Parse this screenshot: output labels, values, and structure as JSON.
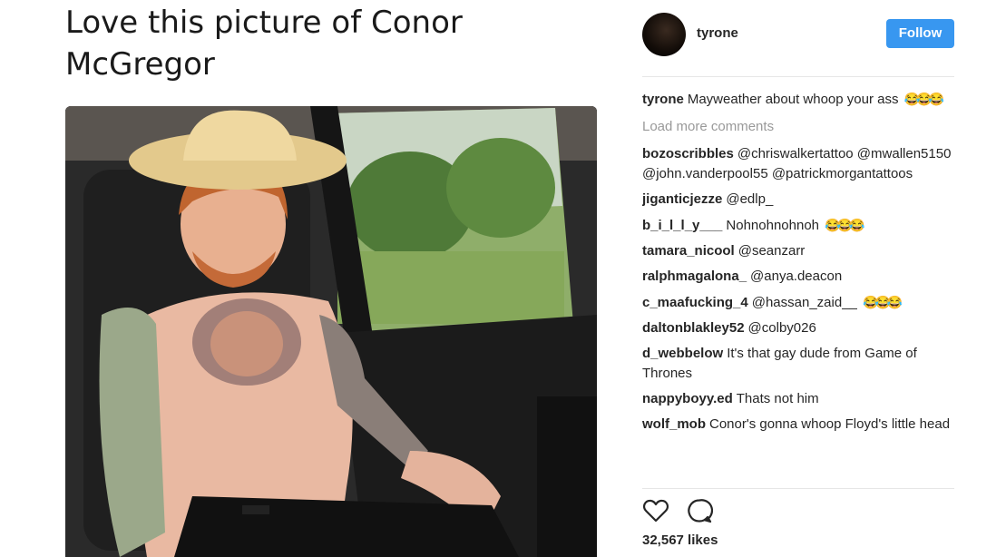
{
  "article": {
    "headline": "Love this picture of Conor McGregor"
  },
  "post": {
    "username": "tyrone",
    "follow_label": "Follow",
    "caption": {
      "user": "tyrone",
      "text": "Mayweather about whoop your ass",
      "emoji": "😂😂😂"
    },
    "load_more_label": "Load more comments",
    "comments": [
      {
        "user": "bozoscribbles",
        "text": "@chriswalkertattoo @mwallen5150 @john.vanderpool55 @patrickmorgantattoos",
        "emoji": ""
      },
      {
        "user": "jiganticjezze",
        "text": "@edlp_",
        "emoji": ""
      },
      {
        "user": "b_i_l_l_y___",
        "text": "Nohnohnohnoh",
        "emoji": "😂😂😂"
      },
      {
        "user": "tamara_nicool",
        "text": "@seanzarr",
        "emoji": ""
      },
      {
        "user": "ralphmagalona_",
        "text": "@anya.deacon",
        "emoji": ""
      },
      {
        "user": "c_maafucking_4",
        "text": "@hassan_zaid__",
        "emoji": "😂😂😂"
      },
      {
        "user": "daltonblakley52",
        "text": "@colby026",
        "emoji": ""
      },
      {
        "user": "d_webbelow",
        "text": "It's that gay dude from Game of Thrones",
        "emoji": ""
      },
      {
        "user": "nappyboyy.ed",
        "text": "Thats not him",
        "emoji": ""
      },
      {
        "user": "wolf_mob",
        "text": "Conor's gonna whoop Floyd's little head",
        "emoji": ""
      }
    ],
    "likes": "32,567 likes",
    "icons": [
      "heart-icon",
      "comment-icon"
    ]
  },
  "colors": {
    "follow_button": "#3897f0",
    "muted_text": "#999999",
    "divider": "#e6e6e6"
  }
}
